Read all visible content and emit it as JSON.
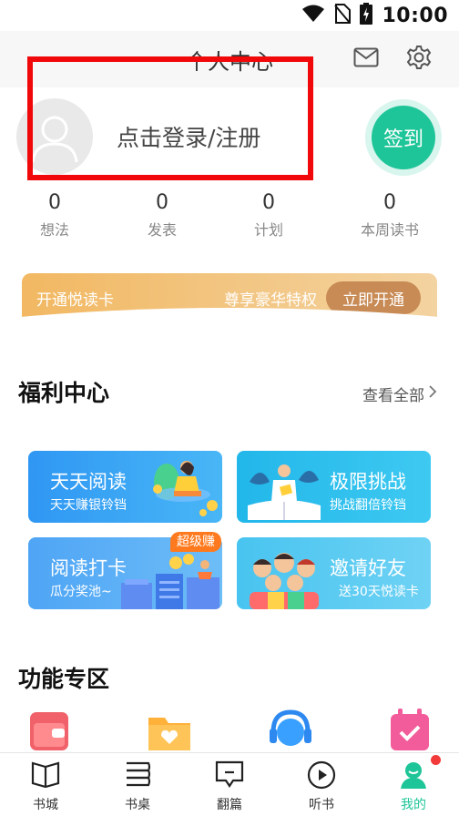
{
  "status_bar": {
    "time": "10:00"
  },
  "header": {
    "title": "个人中心"
  },
  "profile": {
    "login_text": "点击登录/注册",
    "signin_label": "签到",
    "stats": [
      {
        "value": "0",
        "label": "想法"
      },
      {
        "value": "0",
        "label": "发表"
      },
      {
        "value": "0",
        "label": "计划"
      },
      {
        "value": "0",
        "label": "本周读书"
      }
    ]
  },
  "vip": {
    "left_text": "开通悦读卡",
    "mid_text": "尊享豪华特权",
    "button_label": "立即开通"
  },
  "welfare": {
    "title": "福利中心",
    "view_all": "查看全部",
    "cards": [
      {
        "title": "天天阅读",
        "subtitle": "天天赚银铃铛"
      },
      {
        "title": "极限挑战",
        "subtitle": "挑战翻倍铃铛"
      },
      {
        "title": "阅读打卡",
        "subtitle": "瓜分奖池~",
        "badge": "超级赚"
      },
      {
        "title": "邀请好友",
        "subtitle": "送30天悦读卡"
      }
    ]
  },
  "functions": {
    "title": "功能专区",
    "icons": [
      "wallet-icon",
      "folder-heart-icon",
      "headset-service-icon",
      "calendar-check-icon"
    ]
  },
  "bottom_nav": {
    "items": [
      {
        "label": "书城",
        "icon": "open-book-icon"
      },
      {
        "label": "书桌",
        "icon": "bookshelf-icon"
      },
      {
        "label": "翻篇",
        "icon": "chat-square-icon"
      },
      {
        "label": "听书",
        "icon": "play-circle-icon"
      },
      {
        "label": "我的",
        "icon": "profile-icon"
      }
    ],
    "active_index": 4
  },
  "colors": {
    "accent": "#1ec598",
    "vip_gold": "#f2b862",
    "vip_button": "#c88b55",
    "highlight_box": "#f0080a"
  }
}
